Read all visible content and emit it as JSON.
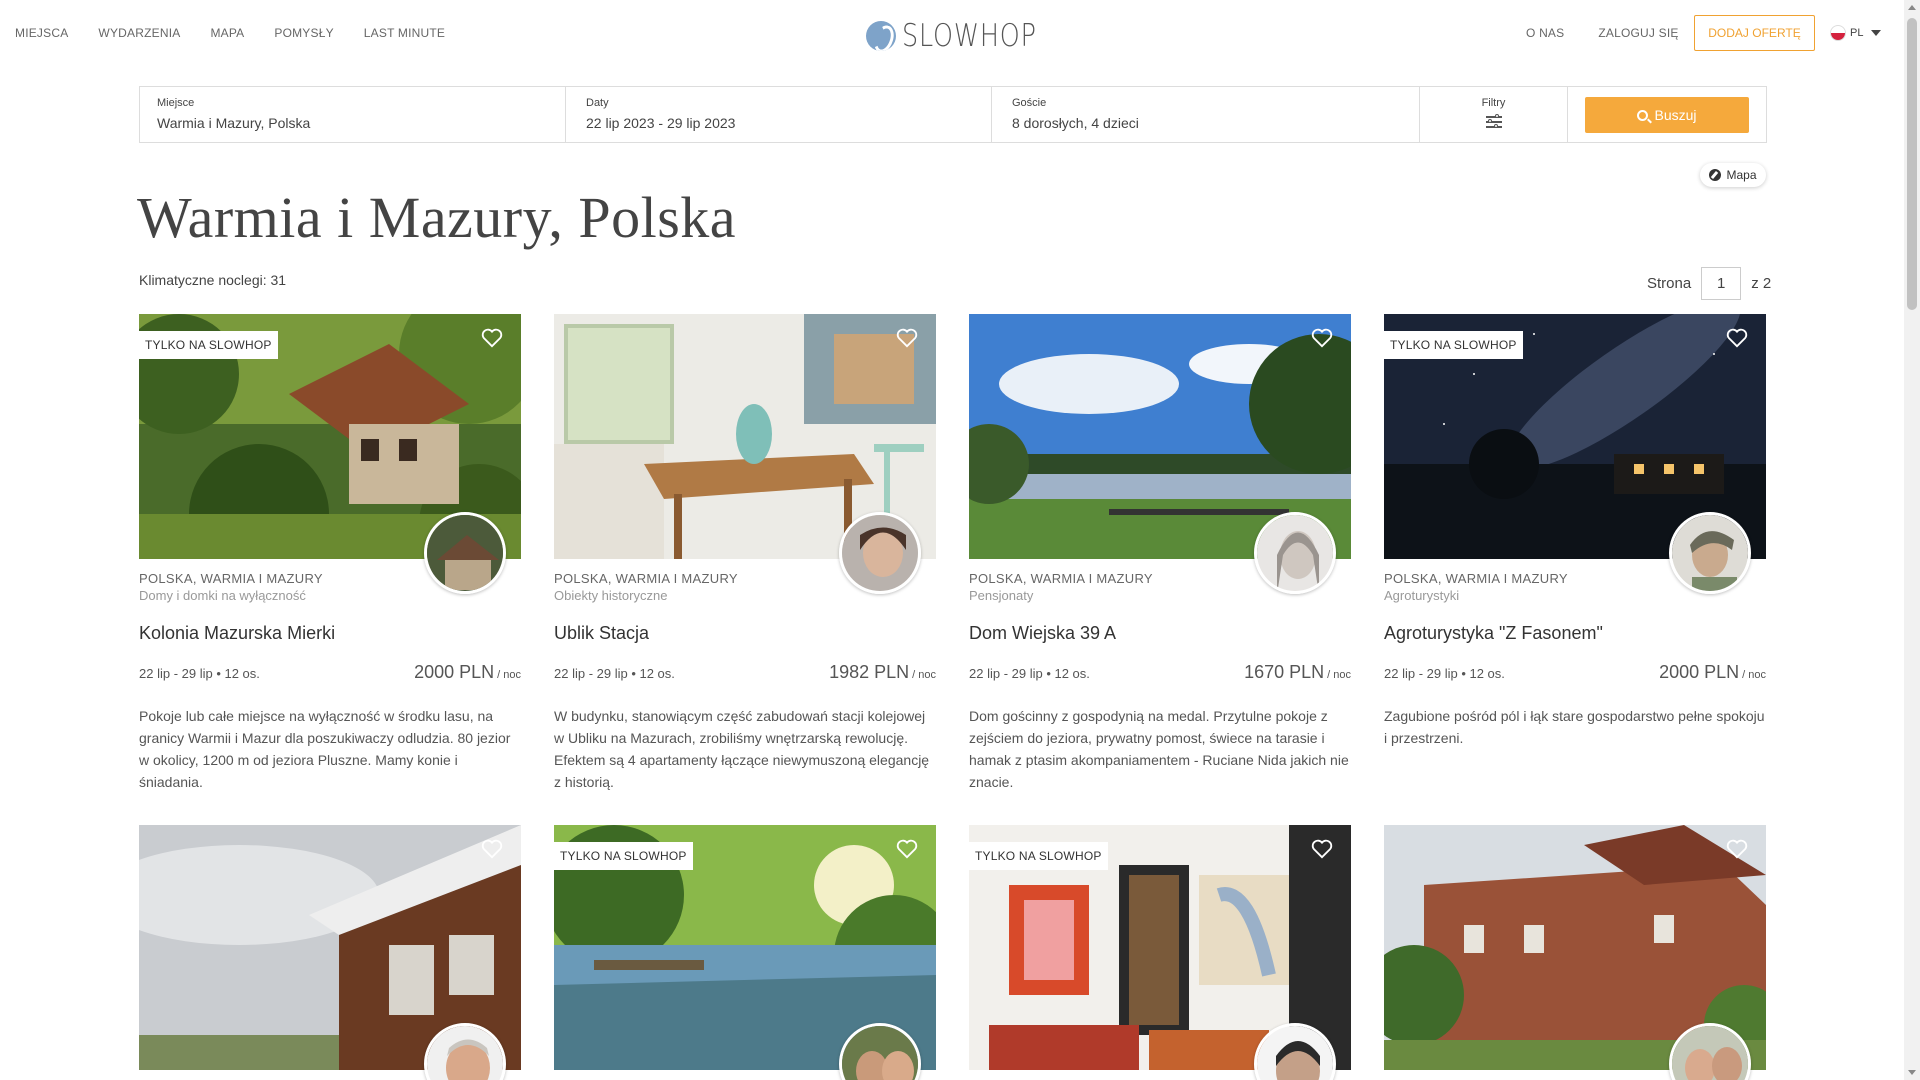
{
  "nav": {
    "left": [
      "MIEJSCA",
      "WYDARZENIA",
      "MAPA",
      "POMYSŁY",
      "LAST MINUTE"
    ],
    "logo": "SLOWHOP",
    "right": [
      "O NAS",
      "ZALOGUJ SIĘ"
    ],
    "cta": "DODAJ OFERTĘ",
    "lang": "PL"
  },
  "search": {
    "place_label": "Miejsce",
    "place_value": "Warmia i Mazury, Polska",
    "dates_label": "Daty",
    "dates_value": "22 lip 2023 - 29 lip 2023",
    "guests_label": "Goście",
    "guests_value": "8 dorosłych, 4 dzieci",
    "filters_label": "Filtry",
    "button": "Buszuj"
  },
  "page": {
    "title": "Warmia i Mazury, Polska",
    "count": "Klimatyczne noclegi: 31",
    "map_button": "Mapa",
    "pager_label": "Strona",
    "pager_current": "1",
    "pager_total": "z 2"
  },
  "listings": [
    {
      "tag": "TYLKO NA SLOWHOP",
      "region": "POLSKA, WARMIA I MAZURY",
      "category": "Domy i domki na wyłączność",
      "name": "Kolonia Mazurska Mierki",
      "dates": "22 lip - 29 lip • 12 os.",
      "price": "2000 PLN",
      "unit": "/ noc",
      "desc": "Pokoje lub całe miejsce na wyłączność w środku lasu, na granicy Warmii i Mazur dla poszukiwaczy odludzia. 80 jezior w okolicy, 1200 m od jeziora Pluszne. Mamy konie i śniadania."
    },
    {
      "tag": "",
      "region": "POLSKA, WARMIA I MAZURY",
      "category": "Obiekty historyczne",
      "name": "Ublik Stacja",
      "dates": "22 lip - 29 lip • 12 os.",
      "price": "1982 PLN",
      "unit": "/ noc",
      "desc": "W budynku, stanowiącym część zabudowań stacji kolejowej w Ubliku na Mazurach, zrobiliśmy wnętrzarską rewolucję. Efektem są 4 apartamenty łączące niewymuszoną elegancję z historią."
    },
    {
      "tag": "",
      "region": "POLSKA, WARMIA I MAZURY",
      "category": "Pensjonaty",
      "name": "Dom Wiejska 39 A",
      "dates": "22 lip - 29 lip • 12 os.",
      "price": "1670 PLN",
      "unit": "/ noc",
      "desc": "Dom gościnny z gospodynią na medal. Przytulne pokoje z zejściem do jeziora, prywatny pomost, świece na tarasie i hamak z ptasim akompaniamentem - Ruciane Nida jakich nie znacie."
    },
    {
      "tag": "TYLKO NA SLOWHOP",
      "region": "POLSKA, WARMIA I MAZURY",
      "category": "Agroturystyki",
      "name": "Agroturystyka \"Z Fasonem\"",
      "dates": "22 lip - 29 lip • 12 os.",
      "price": "2000 PLN",
      "unit": "/ noc",
      "desc": "Zagubione pośród pól i łąk stare gospodarstwo pełne spokoju i przestrzeni."
    },
    {
      "tag": ""
    },
    {
      "tag": "TYLKO NA SLOWHOP"
    },
    {
      "tag": "TYLKO NA SLOWHOP"
    },
    {
      "tag": ""
    }
  ],
  "colors": {
    "accent": "#f0a232",
    "button": "#f5a93c"
  }
}
